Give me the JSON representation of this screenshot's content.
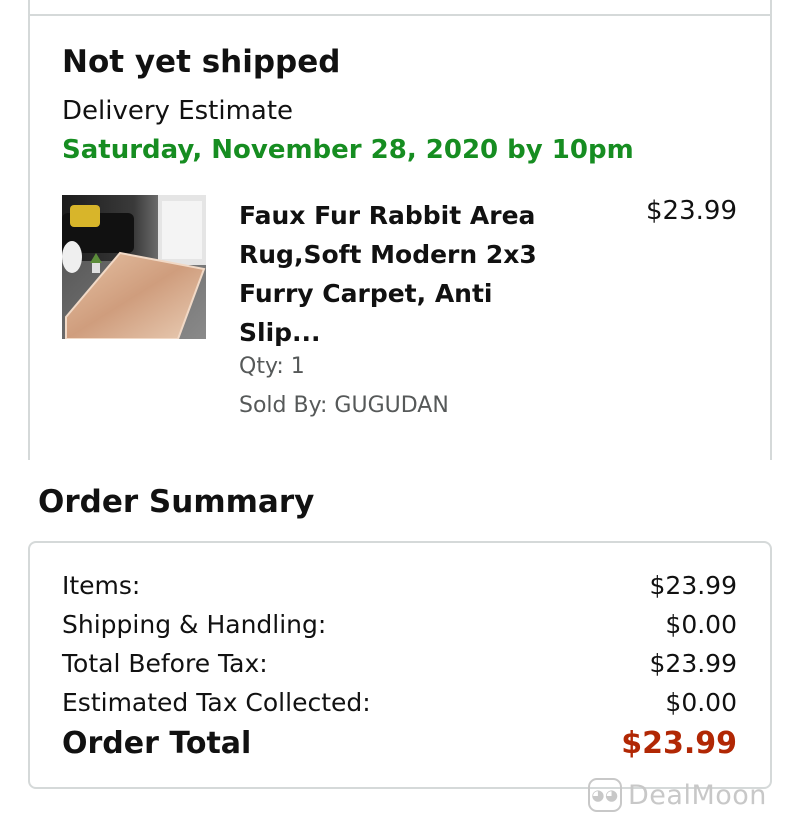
{
  "shipment": {
    "status": "Not yet shipped",
    "delivery_label": "Delivery Estimate",
    "delivery_date": "Saturday, November 28, 2020 by 10pm",
    "item": {
      "title_lines": [
        "Faux Fur Rabbit Area",
        "Rug,Soft Modern 2x3",
        "Furry Carpet, Anti",
        "Slip..."
      ],
      "price": "$23.99",
      "qty": "Qty: 1",
      "sold_by": "Sold By: GUGUDAN",
      "image_icon": "rug-product-photo"
    }
  },
  "summary": {
    "heading": "Order Summary",
    "rows": [
      {
        "label": "Items:",
        "value": "$23.99"
      },
      {
        "label": "Shipping & Handling:",
        "value": "$0.00"
      },
      {
        "label": "Total Before Tax:",
        "value": "$23.99"
      },
      {
        "label": "Estimated Tax Collected:",
        "value": "$0.00"
      }
    ],
    "total": {
      "label": "Order Total",
      "value": "$23.99"
    }
  },
  "watermark": {
    "text": "DealMoon"
  },
  "colors": {
    "delivery_green": "#168d21",
    "total_red": "#b12704",
    "border": "#d5d9d9",
    "muted_text": "#565959"
  }
}
